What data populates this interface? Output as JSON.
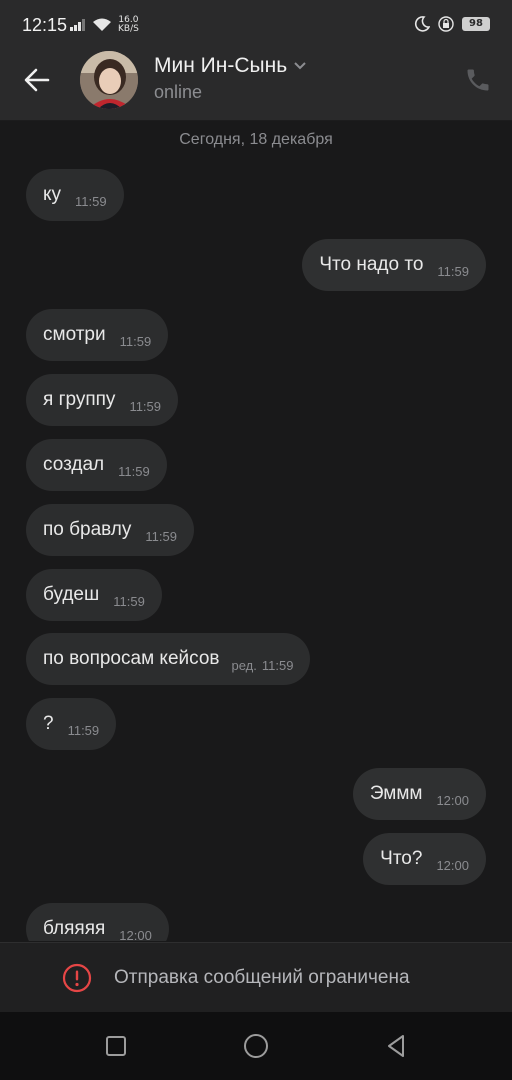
{
  "status_bar": {
    "time": "12:15",
    "net_speed_value": "16.0",
    "net_speed_unit": "KB/S",
    "battery": "98"
  },
  "header": {
    "contact_name": "Мин Ин-Сынь",
    "contact_status": "online"
  },
  "chat": {
    "date_separator": "Сегодня, 18 декабря",
    "messages": [
      {
        "text": "ку",
        "time": "11:59"
      },
      {
        "text": "Что надо то",
        "time": "11:59"
      },
      {
        "text": "смотри",
        "time": "11:59"
      },
      {
        "text": "я группу",
        "time": "11:59"
      },
      {
        "text": "создал",
        "time": "11:59"
      },
      {
        "text": "по бравлу",
        "time": "11:59"
      },
      {
        "text": "будеш",
        "time": "11:59"
      },
      {
        "text": "по вопросам кейсов",
        "edited": "ред.",
        "time": "11:59"
      },
      {
        "text": "?",
        "time": "11:59"
      },
      {
        "text": "Эммм",
        "time": "12:00"
      },
      {
        "text": "Что?",
        "time": "12:00"
      },
      {
        "text": "бляяяя",
        "time": "12:00"
      }
    ]
  },
  "restriction": {
    "text": "Отправка сообщений ограничена"
  },
  "colors": {
    "background": "#19191a",
    "header": "#2a2a2b",
    "bubble": "#2c2d2e",
    "warning": "#e64646"
  }
}
